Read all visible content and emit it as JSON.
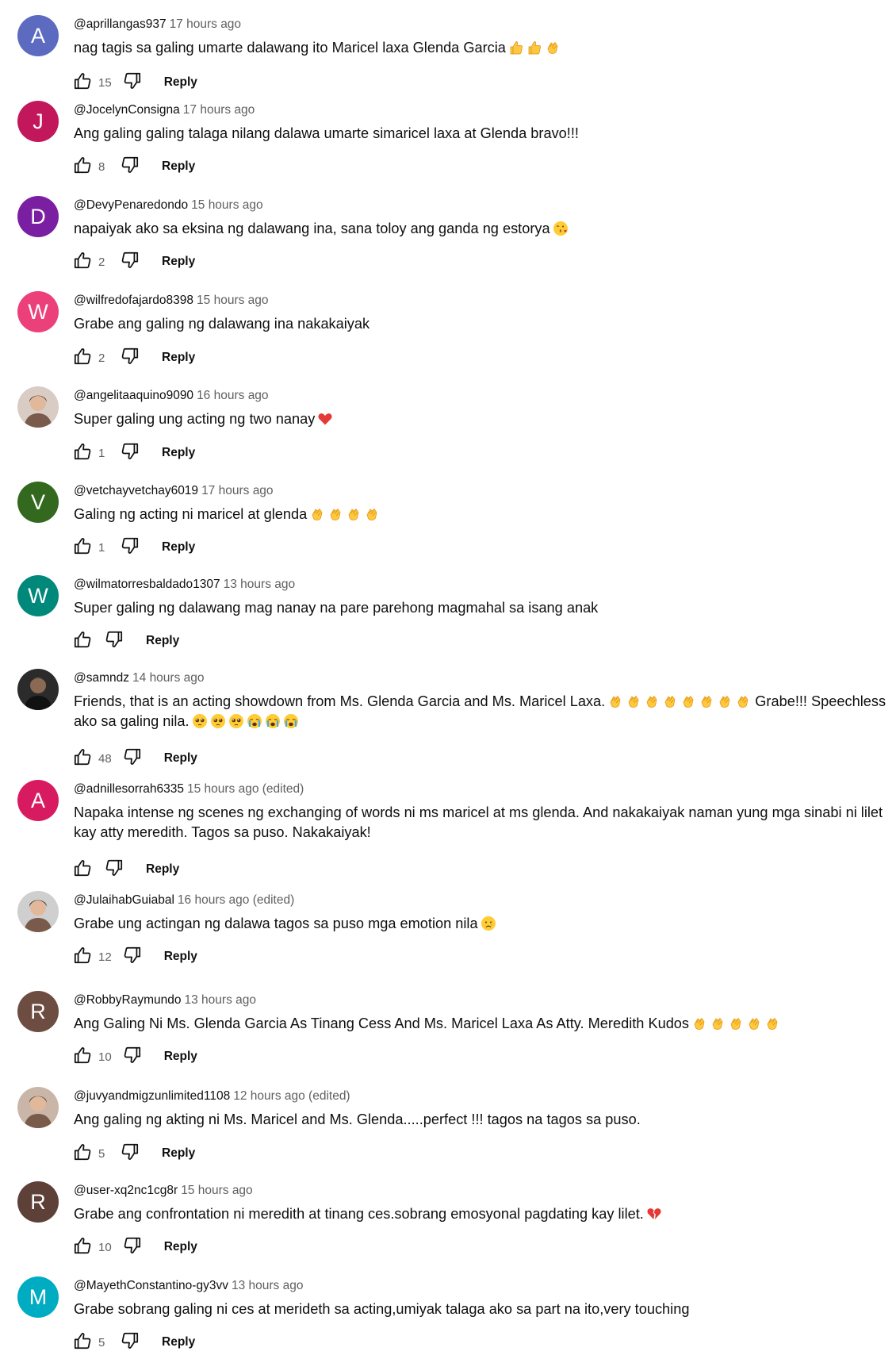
{
  "reply_label": "Reply",
  "comments": [
    {
      "handle": "@aprillangas937",
      "time": "17 hours ago",
      "text": "nag tagis sa galing umarte dalawang ito Maricel laxa Glenda Garcia",
      "emojis": [
        "thumbs-up",
        "thumbs-up",
        "clap"
      ],
      "likes": "15",
      "avatar": {
        "type": "letter",
        "letter": "A",
        "color": "#5c6bc0"
      }
    },
    {
      "handle": "@JocelynConsigna",
      "time": "17 hours ago",
      "text": "Ang galing galing talaga nilang dalawa umarte simaricel laxa at Glenda bravo!!!",
      "emojis": [],
      "likes": "8",
      "avatar": {
        "type": "letter",
        "letter": "J",
        "color": "#c2185b"
      }
    },
    {
      "handle": "@DevyPenaredondo",
      "time": "15 hours ago",
      "text": "napaiyak ako sa eksina ng dalawang ina, sana toloy ang ganda ng estorya",
      "emojis": [
        "kiss-face"
      ],
      "likes": "2",
      "avatar": {
        "type": "letter",
        "letter": "D",
        "color": "#7b1fa2"
      }
    },
    {
      "handle": "@wilfredofajardo8398",
      "time": "15 hours ago",
      "text": "Grabe ang galing ng dalawang ina nakakaiyak",
      "emojis": [],
      "likes": "2",
      "avatar": {
        "type": "letter",
        "letter": "W",
        "color": "#ec407a"
      }
    },
    {
      "handle": "@angelitaaquino9090",
      "time": "16 hours ago",
      "text": "Super galing ung acting ng two nanay",
      "emojis": [
        "red-heart"
      ],
      "likes": "1",
      "avatar": {
        "type": "photo",
        "bg": "#d8ccc4"
      }
    },
    {
      "handle": "@vetchayvetchay6019",
      "time": "17 hours ago",
      "text": "Galing ng acting ni maricel at glenda",
      "emojis": [
        "clap",
        "clap",
        "clap",
        "clap"
      ],
      "likes": "1",
      "avatar": {
        "type": "letter",
        "letter": "V",
        "color": "#33691e"
      }
    },
    {
      "handle": "@wilmatorresbaldado1307",
      "time": "13 hours ago",
      "text": "Super galing ng dalawang mag nanay na pare parehong magmahal sa isang anak",
      "emojis": [],
      "likes": "",
      "avatar": {
        "type": "letter",
        "letter": "W",
        "color": "#00897b"
      }
    },
    {
      "handle": "@samndz",
      "time": "14 hours ago",
      "text": "Friends, that is an acting showdown from Ms. Glenda Garcia and Ms. Maricel Laxa.",
      "emojis": [
        "clap",
        "clap",
        "clap",
        "clap",
        "clap",
        "clap",
        "clap",
        "clap"
      ],
      "text2": "Grabe!!! Speechless ako sa galing nila.",
      "emojis2": [
        "pleading",
        "pleading",
        "pleading",
        "crying",
        "crying",
        "crying"
      ],
      "likes": "48",
      "avatar": {
        "type": "photo",
        "bg": "#2b2b2b"
      }
    },
    {
      "handle": "@adnillesorrah6335",
      "time": "15 hours ago (edited)",
      "text": "Napaka intense ng scenes ng exchanging of words ni ms maricel at ms glenda. And nakakaiyak naman yung mga sinabi ni lilet kay atty meredith. Tagos sa puso. Nakakaiyak!",
      "emojis": [],
      "likes": "",
      "avatar": {
        "type": "letter",
        "letter": "A",
        "color": "#d81b60"
      }
    },
    {
      "handle": "@JulaihabGuiabal",
      "time": "16 hours ago (edited)",
      "text": "Grabe ung actingan ng dalawa tagos sa puso mga emotion nila",
      "emojis": [
        "sad-face"
      ],
      "likes": "12",
      "avatar": {
        "type": "photo",
        "bg": "#cfcfcf"
      }
    },
    {
      "handle": "@RobbyRaymundo",
      "time": "13 hours ago",
      "text": "Ang Galing Ni Ms. Glenda Garcia As Tinang Cess And Ms. Maricel Laxa As Atty. Meredith Kudos",
      "emojis": [
        "clap",
        "clap",
        "clap",
        "clap",
        "clap"
      ],
      "likes": "10",
      "avatar": {
        "type": "letter",
        "letter": "R",
        "color": "#6d4c41"
      }
    },
    {
      "handle": "@juvyandmigzunlimited1108",
      "time": "12 hours ago (edited)",
      "text": "Ang galing ng akting ni Ms. Maricel and Ms. Glenda.....perfect !!! tagos na tagos sa puso.",
      "emojis": [],
      "likes": "5",
      "avatar": {
        "type": "photo",
        "bg": "#c9b6a8"
      }
    },
    {
      "handle": "@user-xq2nc1cg8r",
      "time": "15 hours ago",
      "text": "Grabe ang confrontation ni meredith at tinang ces.sobrang emosyonal pagdating kay lilet.",
      "emojis": [
        "broken-heart"
      ],
      "likes": "10",
      "avatar": {
        "type": "letter",
        "letter": "R",
        "color": "#5d4037"
      }
    },
    {
      "handle": "@MayethConstantino-gy3vv",
      "time": "13 hours ago",
      "text": "Grabe sobrang galing ni ces at merideth sa acting,umiyak talaga ako sa part na ito,very touching",
      "emojis": [],
      "likes": "5",
      "avatar": {
        "type": "letter",
        "letter": "M",
        "color": "#00acc1"
      }
    }
  ]
}
